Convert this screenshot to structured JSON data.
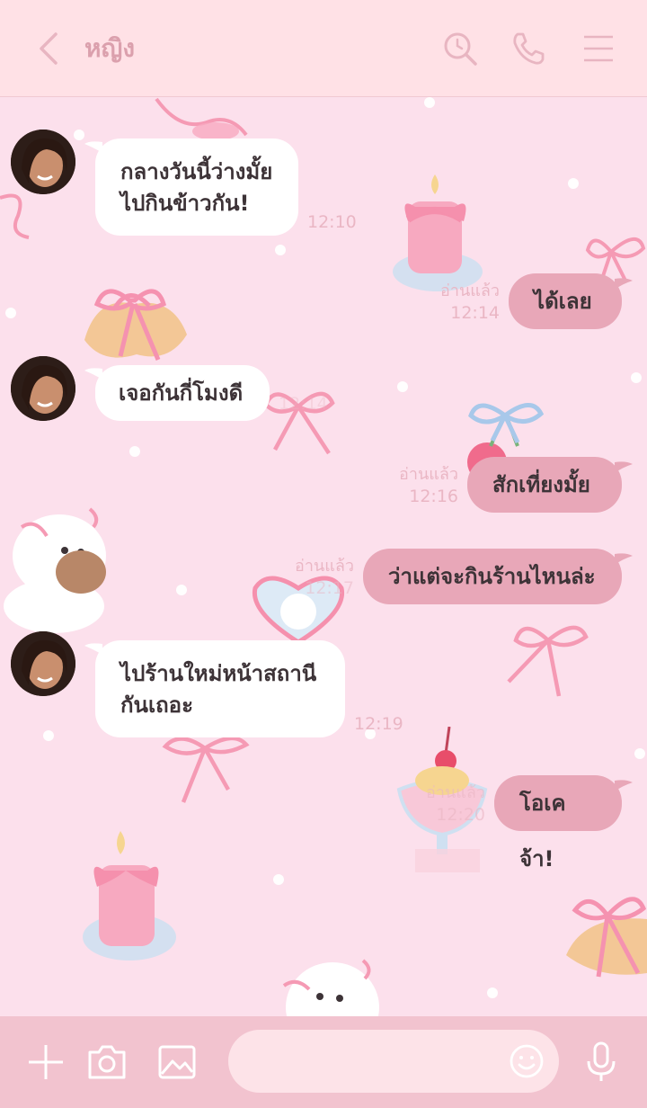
{
  "header": {
    "contact_name": "หญิง"
  },
  "messages": [
    {
      "side": "in",
      "text_lines": [
        "กลางวันนี้ว่างมั้ย",
        "ไปกินข้าวกัน!"
      ],
      "time": "12:10"
    },
    {
      "side": "out",
      "text": "ได้เลย",
      "read": "อ่านแล้ว",
      "time": "12:14"
    },
    {
      "side": "in",
      "text": "เจอกันกี่โมงดี",
      "time": "12:14"
    },
    {
      "side": "out",
      "text": "สักเที่ยงมั้ย",
      "read": "อ่านแล้ว",
      "time": "12:16"
    },
    {
      "side": "out",
      "text": "ว่าแต่จะกินร้านไหนล่ะ",
      "read": "อ่านแล้ว",
      "time": "12:17"
    },
    {
      "side": "in",
      "text_lines": [
        "ไปร้านใหม่หน้าสถานี",
        "กันเถอะ"
      ],
      "time": "12:19"
    },
    {
      "side": "out",
      "text": "โอเคจ้า!",
      "read": "อ่านแล้ว",
      "time": "12:20"
    }
  ],
  "composer": {
    "placeholder": ""
  },
  "icons": {
    "back": "chevron-left-icon",
    "search": "search-icon",
    "call": "phone-icon",
    "menu": "menu-icon",
    "plus": "plus-icon",
    "camera": "camera-icon",
    "image": "image-icon",
    "emoji": "smiley-icon",
    "mic": "microphone-icon"
  },
  "colors": {
    "header_bg": "#ffe1e6",
    "chat_bg": "#fce0ec",
    "outgoing_bubble": "#e8a7b8",
    "incoming_bubble": "#ffffff",
    "footer_bg": "#f2c3cf",
    "icon_tint": "#dba0ad"
  }
}
